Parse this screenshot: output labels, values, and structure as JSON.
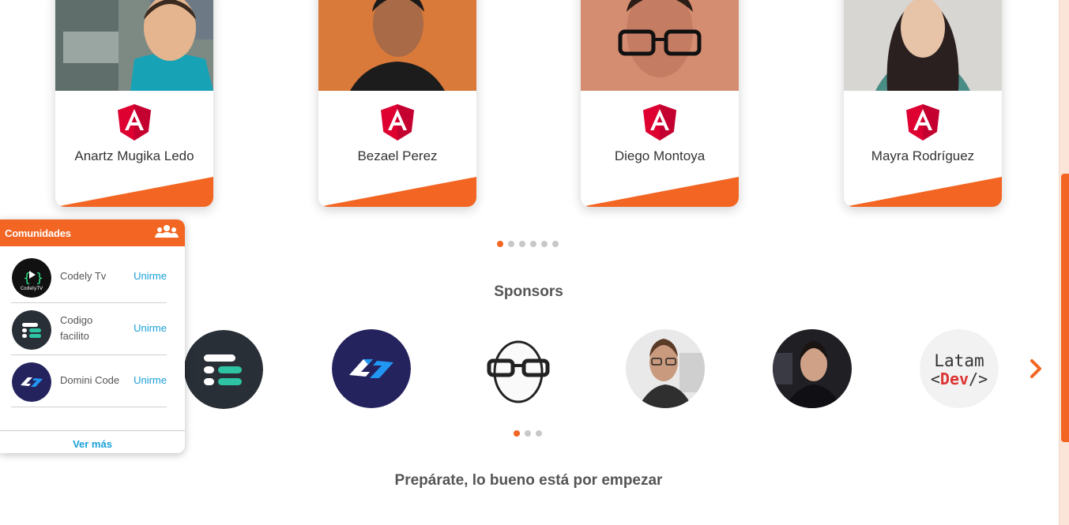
{
  "speakers": [
    {
      "name": "Anartz Mugika Ledo"
    },
    {
      "name": "Bezael Perez"
    },
    {
      "name": "Diego Montoya"
    },
    {
      "name": "Mayra Rodríguez"
    }
  ],
  "speakers_carousel": {
    "pages": 6,
    "active": 0
  },
  "sponsors": {
    "title": "Sponsors",
    "items": [
      {
        "icon": "codigo-facilito-logo"
      },
      {
        "icon": "domini-code-logo"
      },
      {
        "icon": "egghead-glasses-logo"
      },
      {
        "icon": "person-photo"
      },
      {
        "icon": "person-photo"
      },
      {
        "icon": "latam-dev-logo",
        "line1": "Latam",
        "line2_open": "<",
        "line2_word": "Dev",
        "line2_close": "/>"
      }
    ],
    "carousel": {
      "pages": 3,
      "active": 0
    }
  },
  "communities": {
    "title": "Comunidades",
    "items": [
      {
        "name": "Codely Tv",
        "action": "Unirme",
        "logo_text": "CodelyTV"
      },
      {
        "name": "Codigo facilito",
        "action": "Unirme"
      },
      {
        "name": "Domini Code",
        "action": "Unirme"
      }
    ],
    "footer": "Ver más"
  },
  "tagline": "Prepárate, lo bueno está por empezar",
  "colors": {
    "accent": "#f26522",
    "link": "#1aa0d8",
    "angular": "#dd0031"
  }
}
